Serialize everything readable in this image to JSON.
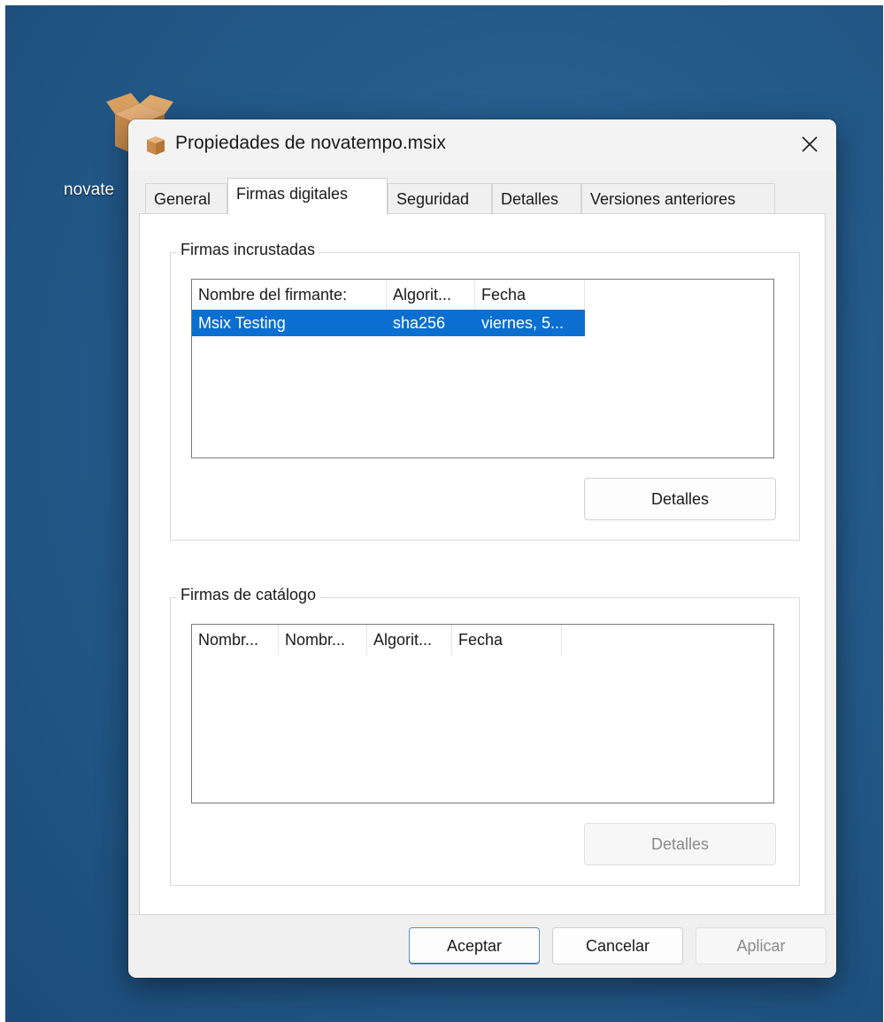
{
  "desktop": {
    "icon_label": "novate"
  },
  "dialog": {
    "title": "Propiedades de novatempo.msix",
    "tabs": [
      {
        "label": "General",
        "active": false
      },
      {
        "label": "Firmas digitales",
        "active": true
      },
      {
        "label": "Seguridad",
        "active": false
      },
      {
        "label": "Detalles",
        "active": false
      },
      {
        "label": "Versiones anteriores",
        "active": false
      }
    ],
    "embedded": {
      "legend": "Firmas incrustadas",
      "columns": [
        "Nombre del firmante:",
        "Algorit...",
        "Fecha"
      ],
      "rows": [
        {
          "signer": "Msix Testing",
          "algorithm": "sha256",
          "date": "viernes, 5...",
          "selected": true
        }
      ],
      "details_button": "Detalles",
      "details_enabled": true
    },
    "catalog": {
      "legend": "Firmas de catálogo",
      "columns": [
        "Nombr...",
        "Nombr...",
        "Algorit...",
        "Fecha"
      ],
      "rows": [],
      "details_button": "Detalles",
      "details_enabled": false
    },
    "buttons": {
      "ok": "Aceptar",
      "cancel": "Cancelar",
      "apply": "Aplicar"
    }
  },
  "icons": {
    "package": "package-box-icon",
    "close": "close-icon"
  },
  "colors": {
    "desktop_bg": "#245b8c",
    "selection": "#0a6fd1",
    "dialog_bg": "#f0f0f0"
  }
}
